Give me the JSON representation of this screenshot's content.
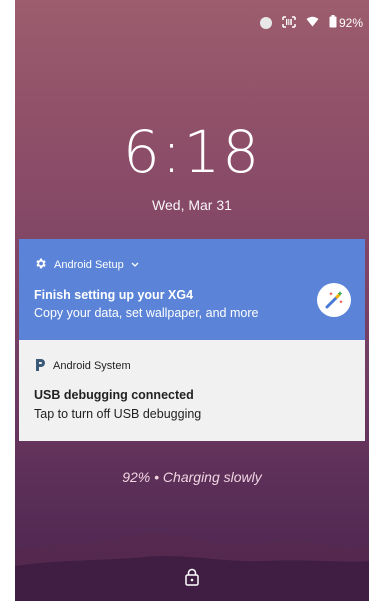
{
  "status_bar": {
    "battery": "92%"
  },
  "lockscreen": {
    "time": "6:18",
    "date": "Wed, Mar 31",
    "charging": "92% • Charging slowly"
  },
  "notifications": [
    {
      "app": "Android Setup",
      "title": "Finish setting up your XG4",
      "body": "Copy your data, set wallpaper, and more",
      "color": "#5b84d8",
      "icon": "gear-icon",
      "action_icon": "magic-wand-icon"
    },
    {
      "app": "Android System",
      "title": "USB debugging connected",
      "body": "Tap to turn off USB debugging",
      "color": "#f2f1f2",
      "icon": "android-system-icon"
    }
  ],
  "icons": [
    "circle-status-icon",
    "scanner-icon",
    "wifi-icon",
    "battery-icon",
    "chevron-down-icon",
    "lock-icon"
  ]
}
